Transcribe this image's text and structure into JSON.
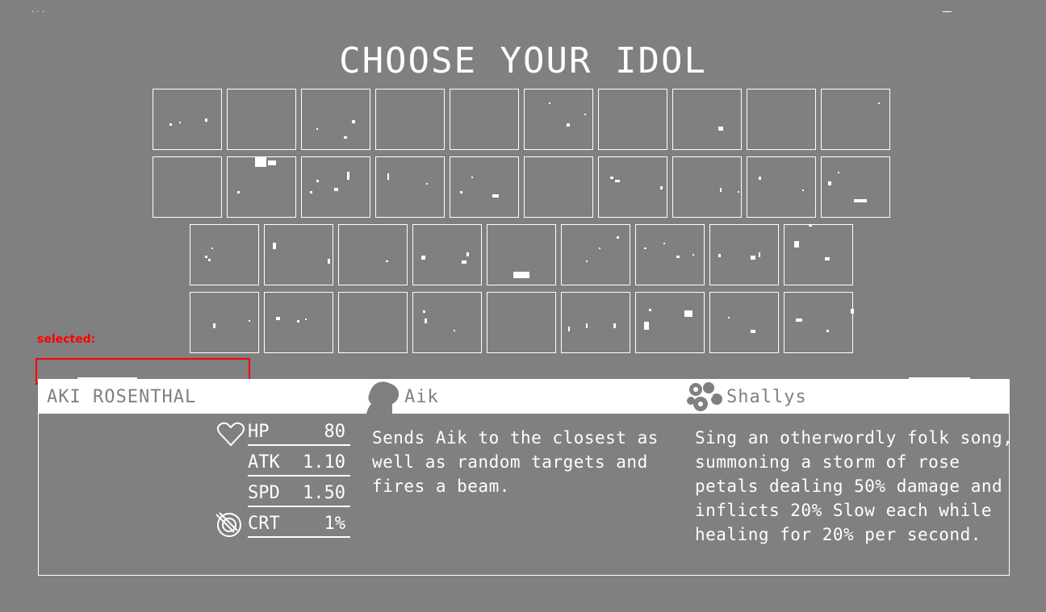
{
  "window": {
    "corner_text": "...",
    "accent": "#ff0000",
    "background": "#808080"
  },
  "title": "CHOOSE YOUR IDOL",
  "roster": {
    "rows": 4,
    "slots": 38
  },
  "selection": {
    "label": "selected:",
    "current": ""
  },
  "idol": {
    "name": "AKI ROSENTHAL",
    "stats": [
      {
        "label": "HP",
        "value": "80",
        "icon": "heart-icon"
      },
      {
        "label": "ATK",
        "value": "1.10",
        "icon": ""
      },
      {
        "label": "SPD",
        "value": "1.50",
        "icon": ""
      },
      {
        "label": "CRT",
        "value": "1%",
        "icon": "crit-target-icon"
      }
    ]
  },
  "skills": [
    {
      "name": "Aik",
      "icon": "aik-silhouette-icon",
      "description": "Sends Aik to the closest as\nwell as random targets and\nfires a beam."
    },
    {
      "name": "Shallys",
      "icon": "rose-petal-icon",
      "description": "Sing an otherwordly folk song,\nsummoning a storm of rose\npetals dealing 50% damage and\ninflicts 20% Slow each while\nhealing for 20% per second."
    }
  ]
}
